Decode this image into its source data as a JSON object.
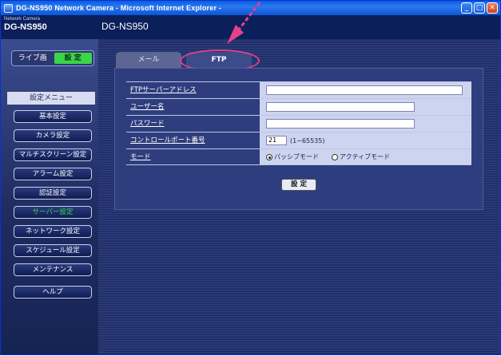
{
  "window": {
    "title": "DG-NS950 Network Camera - Microsoft Internet Explorer -"
  },
  "header": {
    "brand_small": "Network Camera",
    "brand_model": "DG-NS950",
    "device_title": "DG-NS950"
  },
  "mode": {
    "live_label": "ライブ画",
    "setup_label": "設 定"
  },
  "sidebar": {
    "heading": "設定メニュー",
    "items": [
      {
        "label": "基本設定"
      },
      {
        "label": "カメラ設定"
      },
      {
        "label": "マルチスクリーン設定"
      },
      {
        "label": "アラーム設定"
      },
      {
        "label": "認証設定"
      },
      {
        "label": "サーバー設定"
      },
      {
        "label": "ネットワーク設定"
      },
      {
        "label": "スケジュール設定"
      },
      {
        "label": "メンテナンス"
      },
      {
        "label": "ヘルプ"
      }
    ],
    "active_index": 5
  },
  "tabs": [
    {
      "label": "メール"
    },
    {
      "label": "FTP"
    }
  ],
  "form": {
    "server_address_label": "FTPサーバーアドレス",
    "server_address_value": "",
    "username_label": "ユーザー名",
    "username_value": "",
    "password_label": "パスワード",
    "password_value": "",
    "control_port_label": "コントロールポート番号",
    "control_port_value": "21",
    "control_port_hint": "(1~65535)",
    "mode_label": "モード",
    "mode_passive": "パッシブモード",
    "mode_active": "アクティブモード",
    "mode_selected": "passive"
  },
  "actions": {
    "set_label": "設 定"
  },
  "colors": {
    "accent_green": "#3bd44a",
    "highlight_pink": "#e5408c",
    "panel_blue": "#2e3d7d"
  }
}
